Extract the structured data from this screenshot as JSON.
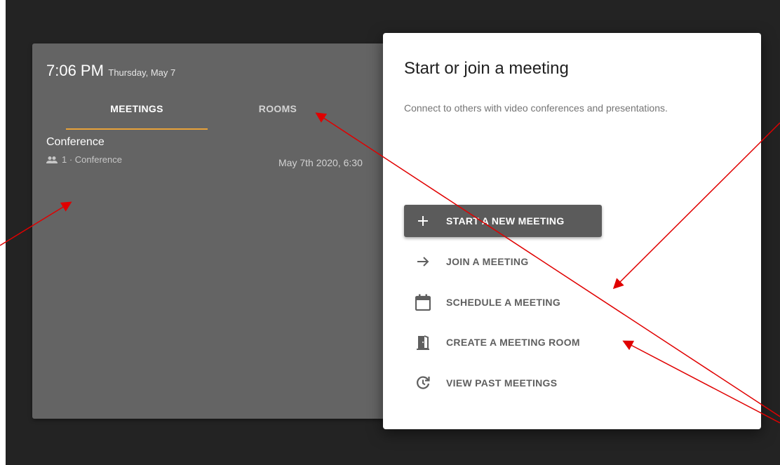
{
  "clock": {
    "time": "7:06 PM",
    "date": "Thursday, May 7"
  },
  "tabs": [
    {
      "label": "MEETINGS",
      "active": true
    },
    {
      "label": "ROOMS",
      "active": false
    }
  ],
  "meetings": [
    {
      "title": "Conference",
      "participants": "1 · Conference",
      "time": "May 7th 2020, 6:30"
    }
  ],
  "dialog": {
    "title": "Start or join a meeting",
    "subtitle": "Connect to others with video conferences and presentations.",
    "actions": [
      {
        "label": "START A NEW MEETING",
        "icon": "plus-icon"
      },
      {
        "label": "JOIN A MEETING",
        "icon": "arrow-right-icon"
      },
      {
        "label": "SCHEDULE A MEETING",
        "icon": "calendar-icon"
      },
      {
        "label": "CREATE A MEETING ROOM",
        "icon": "door-icon"
      },
      {
        "label": "VIEW PAST MEETINGS",
        "icon": "history-icon"
      }
    ]
  },
  "colors": {
    "background": "#232323",
    "panel": "#646464",
    "tab_indicator": "#e8a33a",
    "primary_button": "#5b5b5b",
    "annotation_arrow": "#e00000"
  }
}
